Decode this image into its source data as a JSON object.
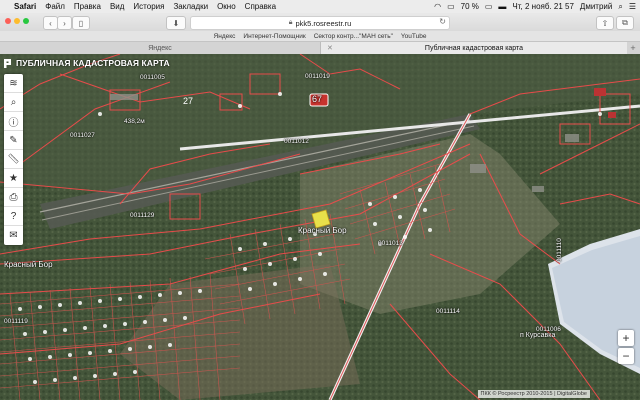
{
  "menubar": {
    "app": "Safari",
    "items": [
      "Файл",
      "Правка",
      "Вид",
      "История",
      "Закладки",
      "Окно",
      "Справка"
    ],
    "battery": "70 %",
    "datetime": "Чт, 2 нояб. 21 57",
    "user": "Дмитрий"
  },
  "toolbar": {
    "url": "pkk5.rosreestr.ru"
  },
  "favorites": [
    "Яндекс",
    "Интернет-Помощник",
    "Сектор контр...\"МАН сеть\"",
    "YouTube"
  ],
  "tabs": [
    {
      "label": "Яндекс",
      "active": false
    },
    {
      "label": "Публичная кадастровая карта",
      "active": true
    }
  ],
  "map": {
    "title": "ПУБЛИЧНАЯ КАДАСТРОВАЯ КАРТА",
    "tools": [
      "layers-icon",
      "search-icon",
      "info-icon",
      "pencil-icon",
      "ruler-icon",
      "star-icon",
      "print-icon",
      "help-icon",
      "mail-icon"
    ],
    "copyright": "ПКК © Росреестр 2010-2015 | DigitalGlobe",
    "labels": {
      "q1": "0011005",
      "q2": "0011019",
      "q3": "0011027",
      "q4": "0011012",
      "q5": "0011129",
      "q6": "0011013",
      "q7": "0011114",
      "q8": "0011119",
      "q9": "0011110",
      "q10": "0011006",
      "km": "438,2м",
      "road67": "67",
      "road27": "27",
      "place1": "Красный Бор",
      "place2": "Красный Бор",
      "place3": "п Курсавка"
    }
  }
}
